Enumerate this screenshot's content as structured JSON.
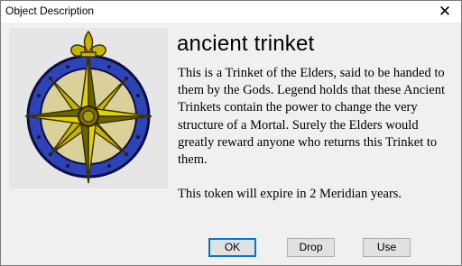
{
  "window": {
    "title": "Object Description",
    "close_glyph": "✕"
  },
  "item": {
    "name": "ancient trinket",
    "description": "This is a Trinket of the Elders, said to be handed to them by the Gods. Legend holds that these Ancient Trinkets contain the power to change the very structure of a Mortal. Surely the Elders would greatly reward anyone who returns this Trinket to them.\n\nThis token will expire in 2 Meridian years.",
    "icon": "compass-star-icon"
  },
  "buttons": {
    "ok": "OK",
    "drop": "Drop",
    "use": "Use"
  },
  "colors": {
    "ring_blue": "#2f43b8",
    "gold": "#c8b400",
    "dark_gold": "#6b6200"
  }
}
